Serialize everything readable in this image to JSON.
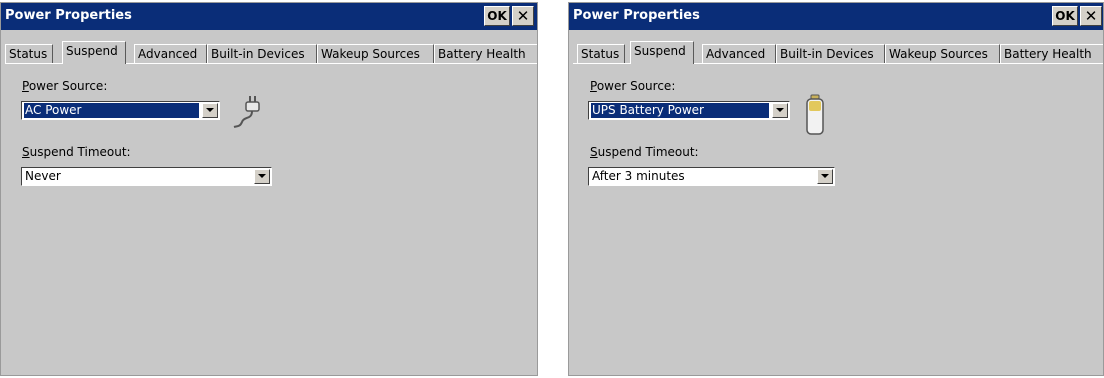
{
  "windows": [
    {
      "title": "Power Properties",
      "ok_label": "OK",
      "close_glyph": "✕",
      "tabs": [
        "Status",
        "Suspend",
        "Advanced",
        "Built-in Devices",
        "Wakeup Sources",
        "Battery Health"
      ],
      "active_tab": "Suspend",
      "power_source": {
        "label_first": "P",
        "label_rest": "ower Source:",
        "value": "AC Power",
        "icon": "ac-plug-icon"
      },
      "suspend_timeout": {
        "label_first": "S",
        "label_rest": "uspend Timeout:",
        "value": "Never"
      }
    },
    {
      "title": "Power Properties",
      "ok_label": "OK",
      "close_glyph": "✕",
      "tabs": [
        "Status",
        "Suspend",
        "Advanced",
        "Built-in Devices",
        "Wakeup Sources",
        "Battery Health"
      ],
      "active_tab": "Suspend",
      "power_source": {
        "label_first": "P",
        "label_rest": "ower Source:",
        "value": "UPS Battery Power",
        "icon": "battery-icon"
      },
      "suspend_timeout": {
        "label_first": "S",
        "label_rest": "uspend Timeout:",
        "value": "After 3 minutes"
      }
    }
  ],
  "colors": {
    "titlebar": "#0a2d78",
    "dialog": "#c8c8c8",
    "selection": "#0a2d78"
  }
}
